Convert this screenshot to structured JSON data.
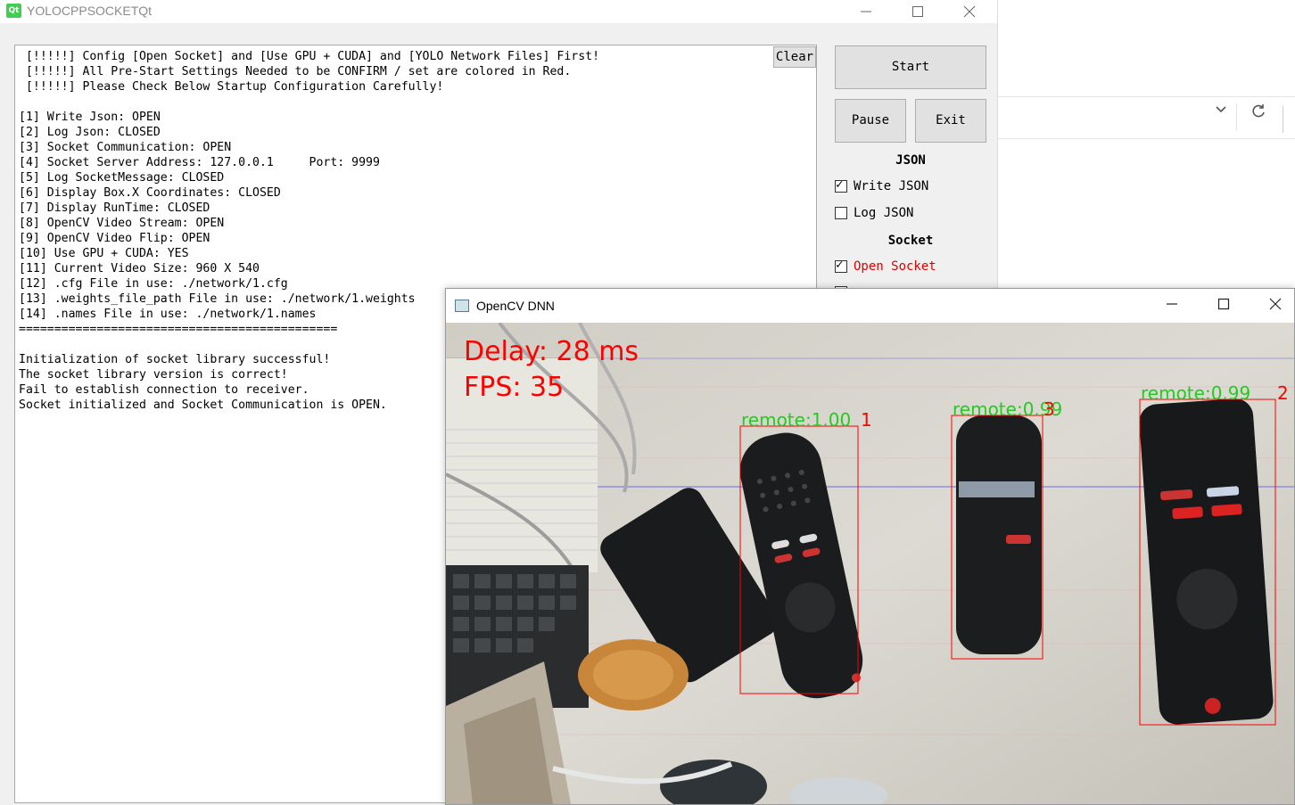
{
  "app": {
    "title": "YOLOCPPSOCKETQt",
    "icon_text": "Qt",
    "titlebar_buttons": {
      "minimize": "—",
      "maximize": "☐",
      "close": "✕"
    }
  },
  "log": {
    "lines": [
      " [!!!!!] Config [Open Socket] and [Use GPU + CUDA] and [YOLO Network Files] First!",
      " [!!!!!] All Pre-Start Settings Needed to be CONFIRM / set are colored in Red.",
      " [!!!!!] Please Check Below Startup Configuration Carefully!",
      "",
      "[1] Write Json: OPEN",
      "[2] Log Json: CLOSED",
      "[3] Socket Communication: OPEN",
      "[4] Socket Server Address: 127.0.0.1     Port: 9999",
      "[5] Log SocketMessage: CLOSED",
      "[6] Display Box.X Coordinates: CLOSED",
      "[7] Display RunTime: CLOSED",
      "[8] OpenCV Video Stream: OPEN",
      "[9] OpenCV Video Flip: OPEN",
      "[10] Use GPU + CUDA: YES",
      "[11] Current Video Size: 960 X 540",
      "[12] .cfg File in use: ./network/1.cfg",
      "[13] .weights_file_path File in use: ./network/1.weights",
      "[14] .names File in use: ./network/1.names",
      "=============================================",
      "",
      "Initialization of socket library successful!",
      "The socket library version is correct!",
      "Fail to establish connection to receiver.",
      "Socket initialized and Socket Communication is OPEN."
    ],
    "clear_label": "Clear"
  },
  "controls": {
    "start_label": "Start",
    "pause_label": "Pause",
    "exit_label": "Exit",
    "json_group": "JSON",
    "write_json": {
      "label": "Write JSON",
      "checked": true
    },
    "log_json": {
      "label": "Log JSON",
      "checked": false
    },
    "socket_group": "Socket",
    "open_socket": {
      "label": "Open Socket",
      "checked": true,
      "color": "#e00000"
    }
  },
  "opencv": {
    "title": "OpenCV DNN",
    "titlebar_buttons": {
      "minimize": "—",
      "maximize": "☐",
      "close": "✕"
    },
    "overlay": {
      "delay_text": "Delay: 28 ms",
      "fps_text": "FPS: 35",
      "overlay_color": "#ff0000",
      "label_color": "#22cc22",
      "box_color": "#ff0000"
    },
    "detections": [
      {
        "label": "remote:1.00",
        "id_suffix": "1"
      },
      {
        "label": "remote:0.99",
        "id_suffix": "3"
      },
      {
        "label": "remote:0.99",
        "id_suffix": "2"
      }
    ]
  },
  "background_window": {
    "chevron_icon": "chevron-down-icon",
    "refresh_icon": "refresh-icon"
  }
}
